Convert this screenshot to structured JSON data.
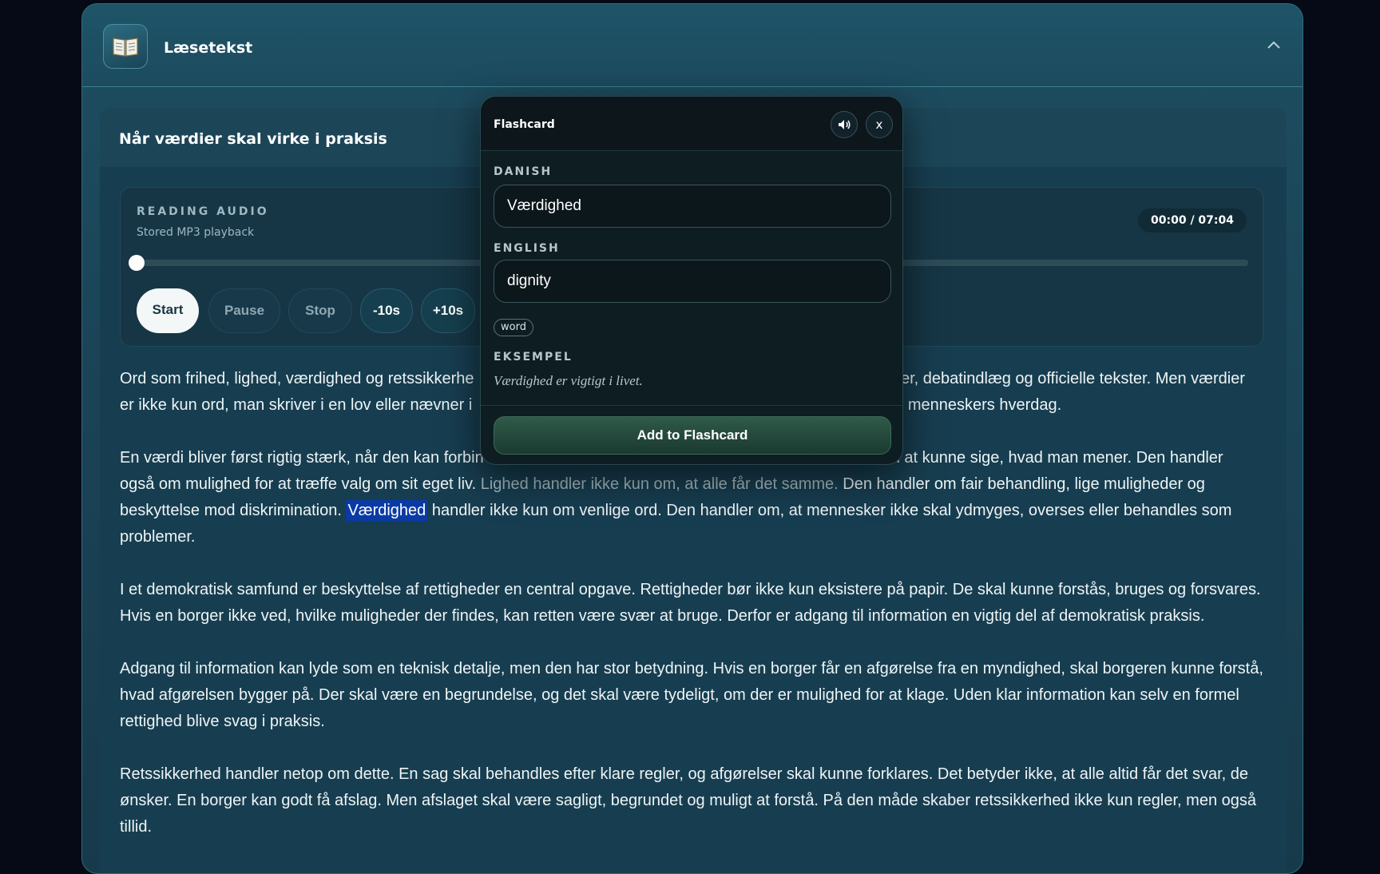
{
  "header": {
    "title": "Læsetekst",
    "icon": "open-book-icon"
  },
  "card": {
    "title": "Når værdier skal virke i praksis"
  },
  "audio": {
    "label": "READING AUDIO",
    "subtitle": "Stored MP3 playback",
    "time": "00:00 / 07:04",
    "progress": 0.0,
    "buttons": {
      "start": "Start",
      "pause": "Pause",
      "stop": "Stop",
      "back": "-10s",
      "forward": "+10s"
    }
  },
  "article": {
    "p1_a": "Ord som frihed, lighed, værdighed og retssikkerhe",
    "p1_b": "ler, debatindlæg og officielle tekster. Men værdier",
    "p1_c": "er ikke kun ord, man skriver i en lov eller nævner i",
    "p1_d": " i menneskers hverdag.",
    "p2_a": "En værdi bliver først rigtig stærk, når den kan forbin",
    "p2_b": "n at kunne sige, hvad man mener. Den handler",
    "p2_c": "også om mulighed for at træffe valg om sit eget liv. ",
    "p2_dim": "Lighed handler ikke kun om, at alle får det samme.",
    "p2_d": " Den handler om fair behandling, lige muligheder og beskyttelse mod diskrimination. ",
    "p2_highlight": "Værdighed",
    "p2_e": " handler ikke kun om venlige ord. Den handler om, at mennesker ikke skal ydmyges, overses eller behandles som problemer.",
    "p3": "I et demokratisk samfund er beskyttelse af rettigheder en central opgave. Rettigheder bør ikke kun eksistere på papir. De skal kunne forstås, bruges og forsvares. Hvis en borger ikke ved, hvilke muligheder der findes, kan retten være svær at bruge. Derfor er adgang til information en vigtig del af demokratisk praksis.",
    "p4": "Adgang til information kan lyde som en teknisk detalje, men den har stor betydning. Hvis en borger får en afgørelse fra en myndighed, skal borgeren kunne forstå, hvad afgørelsen bygger på. Der skal være en begrundelse, og det skal være tydeligt, om der er mulighed for at klage. Uden klar information kan selv en formel rettighed blive svag i praksis.",
    "p5": "Retssikkerhed handler netop om dette. En sag skal behandles efter klare regler, og afgørelser skal kunne forklares. Det betyder ikke, at alle altid får det svar, de ønsker. En borger kan godt få afslag. Men afslaget skal være sagligt, begrundet og muligt at forstå. På den måde skaber retssikkerhed ikke kun regler, men også tillid."
  },
  "flashcard": {
    "title": "Flashcard",
    "close_label": "x",
    "speaker_icon": "speaker-icon",
    "danish_label": "DANISH",
    "danish_value": "Værdighed",
    "english_label": "ENGLISH",
    "english_value": "dignity",
    "tag": "word",
    "example_label": "EKSEMPEL",
    "example": "Værdighed er vigtigt i livet.",
    "add_button": "Add to Flashcard"
  },
  "colors": {
    "highlight": "#0a3aa6",
    "panel": "#1b4558",
    "modal": "#0e1d22"
  }
}
